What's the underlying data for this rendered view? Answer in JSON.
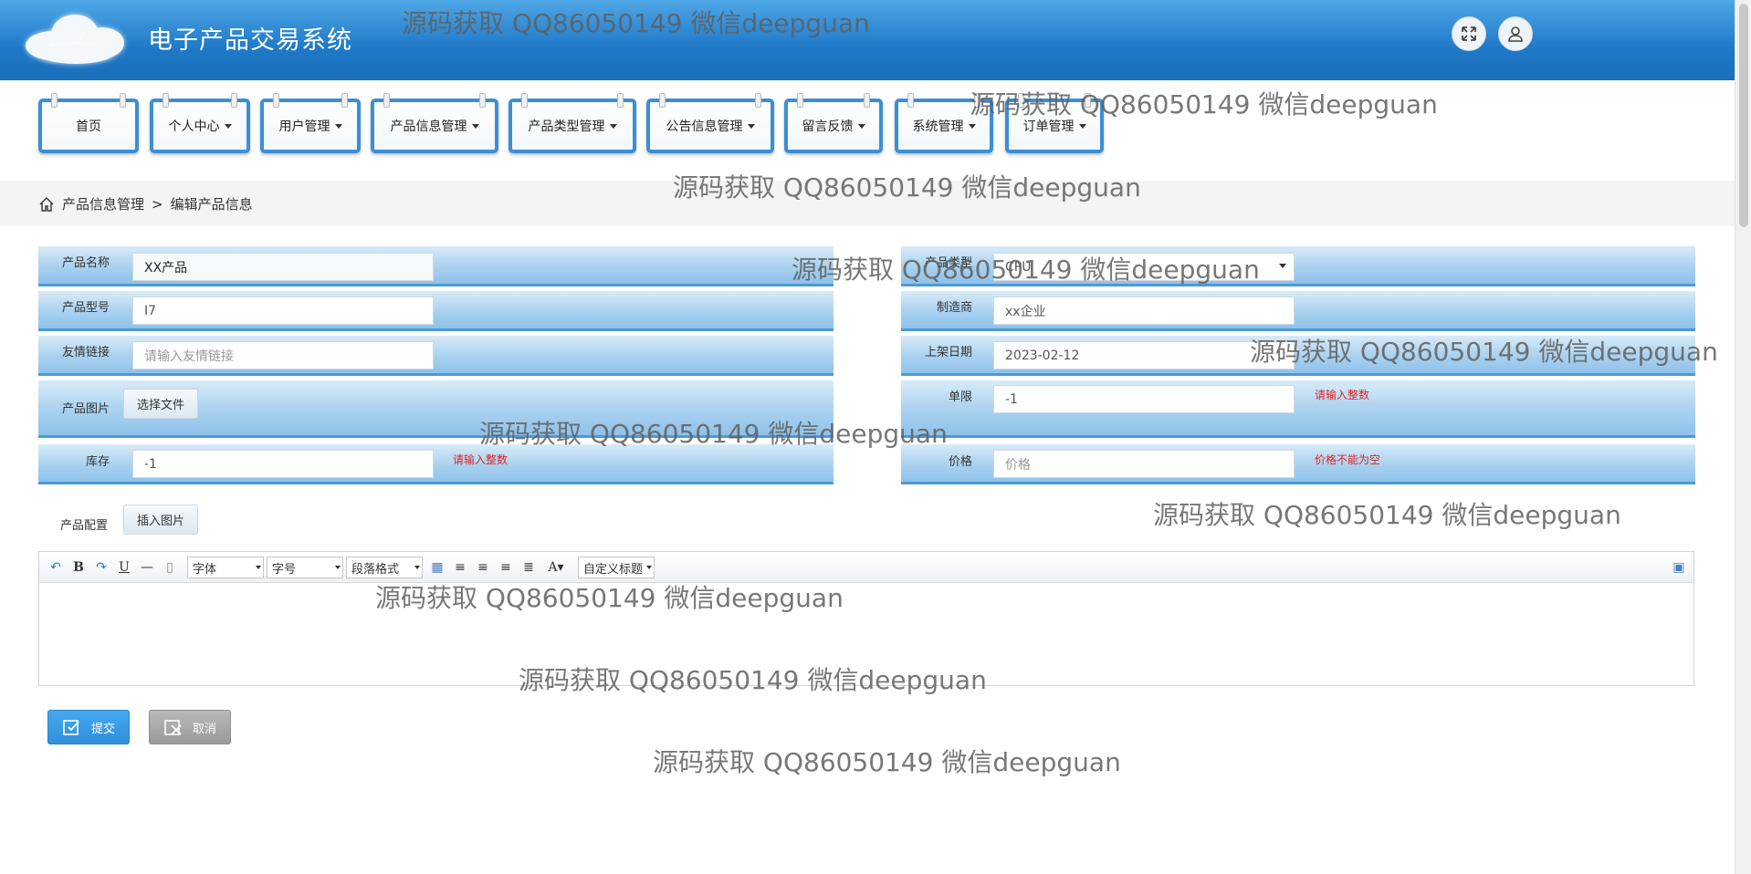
{
  "header": {
    "title": "电子产品交易系统"
  },
  "nav": {
    "items": [
      {
        "label": "首页"
      },
      {
        "label": "个人中心"
      },
      {
        "label": "用户管理"
      },
      {
        "label": "产品信息管理"
      },
      {
        "label": "产品类型管理"
      },
      {
        "label": "公告信息管理"
      },
      {
        "label": "留言反馈"
      },
      {
        "label": "系统管理"
      },
      {
        "label": "订单管理"
      }
    ]
  },
  "breadcrumb": {
    "parent": "产品信息管理",
    "separator": ">",
    "current": "编辑产品信息"
  },
  "form": {
    "name": {
      "label": "产品名称",
      "value": "XX产品"
    },
    "type": {
      "label": "产品类型",
      "value": "CPU"
    },
    "model": {
      "label": "产品型号",
      "value": "I7"
    },
    "maker": {
      "label": "制造商",
      "value": "xx企业"
    },
    "link": {
      "label": "友情链接",
      "placeholder": "请输入友情链接"
    },
    "date": {
      "label": "上架日期",
      "value": "2023-02-12"
    },
    "image": {
      "label": "产品图片",
      "button": "选择文件"
    },
    "limit": {
      "label": "单限",
      "value": "-1",
      "error": "请输入整数"
    },
    "stock": {
      "label": "库存",
      "value": "-1",
      "error": "请输入整数"
    },
    "price": {
      "label": "价格",
      "placeholder": "价格",
      "error": "价格不能为空"
    },
    "config": {
      "label": "产品配置",
      "button": "插入图片"
    }
  },
  "editor": {
    "font_select": "字体",
    "size_select": "字号",
    "paragraph_select": "段落格式",
    "custom_title_select": "自定义标题"
  },
  "actions": {
    "submit": "提交",
    "cancel": "取消"
  },
  "watermark": "源码获取 QQ86050149 微信deepguan",
  "colors": {
    "header": "#1f79c8",
    "accent": "#3a8fd6",
    "error": "#e02424"
  }
}
